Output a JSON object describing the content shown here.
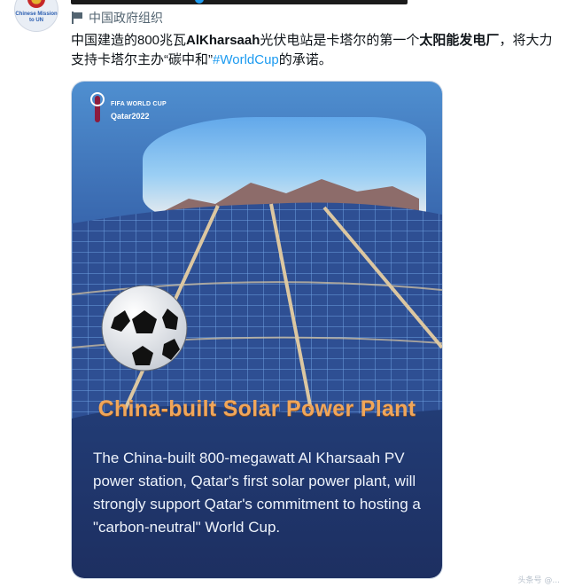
{
  "account": {
    "avatar_alt": "Chinese Mission to UN",
    "label": "中国政府组织"
  },
  "tweet": {
    "text_parts": [
      {
        "text": "中国建造的800兆瓦",
        "bold": false,
        "link": false
      },
      {
        "text": "AlKharsaah",
        "bold": true,
        "link": false
      },
      {
        "text": "光伏电站是卡塔尔的第一个",
        "bold": false,
        "link": false
      },
      {
        "text": "太阳能发电厂",
        "bold": true,
        "link": false
      },
      {
        "text": "，将大力支持卡塔尔主办“碳中和”",
        "bold": false,
        "link": false
      },
      {
        "text": "#WorldCup",
        "bold": false,
        "link": true
      },
      {
        "text": "的承诺。",
        "bold": false,
        "link": false
      }
    ]
  },
  "card": {
    "logo_line1": "FIFA WORLD CUP",
    "logo_line2": "Qatar2022",
    "headline": "China-built Solar Power Plant",
    "body": "The China-built 800-megawatt Al Kharsaah PV power station, Qatar's first solar power plant, will strongly support Qatar's commitment to hosting a \"carbon-neutral\" World Cup."
  },
  "colors": {
    "hashtag": "#1d9bf0",
    "headline": "#f0a65a",
    "card_top": "#4f8fd0",
    "card_bottom": "#1d2f61"
  },
  "icons": [
    "flag-icon",
    "verified-badge-icon",
    "fifa-trophy-icon",
    "soccer-ball-icon"
  ],
  "watermark": "头条号 @..."
}
